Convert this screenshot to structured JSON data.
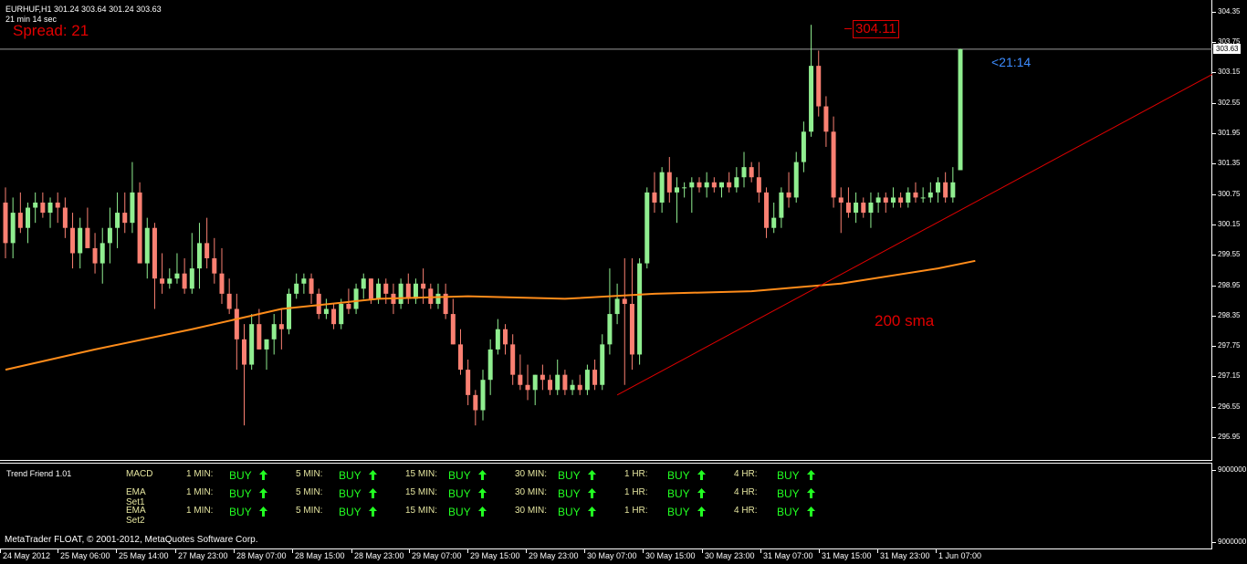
{
  "header": {
    "symbol_line": "EURHUF,H1  301.24 303.64 301.24 303.63",
    "timer_line": "21 min 14 sec",
    "spread": "Spread: 21",
    "high_price": "304.11",
    "countdown": "<21:14",
    "sma_label": "200 sma"
  },
  "price_axis": {
    "ticks": [
      "304.35",
      "303.75",
      "303.15",
      "302.55",
      "301.95",
      "301.35",
      "300.75",
      "300.15",
      "299.55",
      "298.95",
      "298.35",
      "297.75",
      "297.15",
      "296.55",
      "295.95"
    ],
    "current_price": "303.63"
  },
  "indicator": {
    "name": "Trend Friend 1.01",
    "axis_ticks": [
      "9000000",
      "9000000"
    ],
    "rows": [
      {
        "label": "MACD",
        "cells": [
          {
            "tf": "1 MIN:",
            "signal": "BUY"
          },
          {
            "tf": "5 MIN:",
            "signal": "BUY"
          },
          {
            "tf": "15 MIN:",
            "signal": "BUY"
          },
          {
            "tf": "30 MIN:",
            "signal": "BUY"
          },
          {
            "tf": "1 HR:",
            "signal": "BUY"
          },
          {
            "tf": "4 HR:",
            "signal": "BUY"
          }
        ]
      },
      {
        "label": "EMA Set1",
        "cells": [
          {
            "tf": "1 MIN:",
            "signal": "BUY"
          },
          {
            "tf": "5 MIN:",
            "signal": "BUY"
          },
          {
            "tf": "15 MIN:",
            "signal": "BUY"
          },
          {
            "tf": "30 MIN:",
            "signal": "BUY"
          },
          {
            "tf": "1 HR:",
            "signal": "BUY"
          },
          {
            "tf": "4 HR:",
            "signal": "BUY"
          }
        ]
      },
      {
        "label": "EMA Set2",
        "cells": [
          {
            "tf": "1 MIN:",
            "signal": "BUY"
          },
          {
            "tf": "5 MIN:",
            "signal": "BUY"
          },
          {
            "tf": "15 MIN:",
            "signal": "BUY"
          },
          {
            "tf": "30 MIN:",
            "signal": "BUY"
          },
          {
            "tf": "1 HR:",
            "signal": "BUY"
          },
          {
            "tf": "4 HR:",
            "signal": "BUY"
          }
        ]
      }
    ],
    "copyright": "MetaTrader FLOAT, © 2001-2012, MetaQuotes Software Corp."
  },
  "time_axis": {
    "ticks": [
      "24 May 2012",
      "25 May 06:00",
      "25 May 14:00",
      "27 May 23:00",
      "28 May 07:00",
      "28 May 15:00",
      "28 May 23:00",
      "29 May 07:00",
      "29 May 15:00",
      "29 May 23:00",
      "30 May 07:00",
      "30 May 15:00",
      "30 May 23:00",
      "31 May 07:00",
      "31 May 15:00",
      "31 May 23:00",
      "1 Jun 07:00"
    ]
  },
  "colors": {
    "bull": "#90ee90",
    "bear": "#fa8072",
    "sma": "#ff8c1a",
    "trendline": "#e00000",
    "signal": "#22ff22"
  },
  "chart_data": {
    "type": "candlestick",
    "symbol": "EURHUF",
    "timeframe": "H1",
    "ylim": [
      295.8,
      304.5
    ],
    "candles": [
      [
        300.6,
        300.9,
        299.5,
        299.8
      ],
      [
        299.8,
        300.7,
        299.5,
        300.4
      ],
      [
        300.4,
        300.8,
        300.0,
        300.1
      ],
      [
        300.1,
        300.6,
        299.8,
        300.5
      ],
      [
        300.5,
        300.8,
        300.2,
        300.6
      ],
      [
        300.6,
        300.8,
        300.3,
        300.4
      ],
      [
        300.4,
        300.7,
        300.1,
        300.6
      ],
      [
        300.6,
        300.8,
        300.2,
        300.5
      ],
      [
        300.5,
        300.7,
        299.9,
        300.1
      ],
      [
        300.1,
        300.4,
        299.3,
        299.6
      ],
      [
        299.6,
        300.3,
        299.3,
        300.1
      ],
      [
        300.1,
        300.5,
        299.7,
        299.7
      ],
      [
        299.7,
        300.0,
        299.2,
        299.4
      ],
      [
        299.4,
        300.1,
        299.0,
        299.8
      ],
      [
        299.8,
        300.5,
        299.4,
        300.1
      ],
      [
        300.1,
        300.8,
        299.7,
        300.4
      ],
      [
        300.4,
        300.8,
        300.0,
        300.2
      ],
      [
        300.2,
        301.4,
        300.0,
        300.8
      ],
      [
        300.8,
        301.0,
        299.4,
        299.4
      ],
      [
        299.4,
        300.3,
        299.1,
        300.1
      ],
      [
        300.1,
        300.2,
        298.5,
        299.1
      ],
      [
        299.1,
        299.6,
        298.8,
        299.0
      ],
      [
        299.0,
        299.3,
        298.9,
        299.1
      ],
      [
        299.1,
        299.6,
        299.0,
        299.2
      ],
      [
        299.2,
        299.5,
        298.8,
        298.9
      ],
      [
        298.9,
        300.0,
        298.8,
        299.3
      ],
      [
        299.3,
        300.2,
        298.9,
        299.8
      ],
      [
        299.8,
        300.3,
        299.3,
        299.5
      ],
      [
        299.5,
        299.9,
        299.0,
        299.2
      ],
      [
        299.2,
        299.7,
        298.6,
        298.8
      ],
      [
        298.8,
        299.1,
        298.4,
        298.5
      ],
      [
        298.5,
        298.8,
        297.3,
        297.9
      ],
      [
        297.9,
        298.2,
        296.2,
        297.4
      ],
      [
        297.4,
        298.4,
        297.3,
        298.2
      ],
      [
        298.2,
        298.5,
        297.7,
        297.7
      ],
      [
        297.7,
        297.9,
        297.3,
        297.9
      ],
      [
        297.9,
        298.4,
        297.6,
        298.2
      ],
      [
        298.2,
        298.5,
        297.7,
        298.1
      ],
      [
        298.1,
        298.9,
        298.0,
        298.8
      ],
      [
        298.8,
        299.2,
        298.7,
        299.0
      ],
      [
        299.0,
        299.2,
        298.8,
        299.1
      ],
      [
        299.1,
        299.2,
        298.6,
        298.8
      ],
      [
        298.8,
        298.9,
        298.3,
        298.4
      ],
      [
        298.4,
        298.7,
        298.3,
        298.5
      ],
      [
        298.5,
        298.6,
        298.1,
        298.2
      ],
      [
        298.2,
        298.7,
        298.1,
        298.6
      ],
      [
        298.6,
        298.9,
        298.4,
        298.5
      ],
      [
        298.5,
        299.0,
        298.4,
        298.9
      ],
      [
        298.9,
        299.2,
        298.7,
        299.1
      ],
      [
        299.1,
        299.1,
        298.6,
        298.7
      ],
      [
        298.7,
        299.1,
        298.6,
        299.0
      ],
      [
        299.0,
        299.1,
        298.6,
        298.8
      ],
      [
        298.8,
        299.0,
        298.4,
        298.6
      ],
      [
        298.6,
        299.1,
        298.5,
        299.0
      ],
      [
        299.0,
        299.2,
        298.6,
        298.7
      ],
      [
        298.7,
        299.1,
        298.6,
        299.0
      ],
      [
        299.0,
        299.3,
        298.6,
        298.9
      ],
      [
        298.9,
        299.0,
        298.5,
        298.6
      ],
      [
        298.6,
        299.0,
        298.5,
        298.8
      ],
      [
        298.8,
        299.0,
        298.3,
        298.4
      ],
      [
        298.4,
        298.7,
        297.8,
        297.8
      ],
      [
        297.8,
        298.1,
        297.2,
        297.3
      ],
      [
        297.3,
        297.5,
        296.6,
        296.8
      ],
      [
        296.8,
        296.9,
        296.2,
        296.5
      ],
      [
        296.5,
        297.3,
        296.3,
        297.1
      ],
      [
        297.1,
        297.9,
        296.8,
        297.7
      ],
      [
        297.7,
        298.3,
        297.6,
        298.1
      ],
      [
        298.1,
        298.2,
        297.6,
        297.8
      ],
      [
        297.8,
        298.0,
        297.0,
        297.2
      ],
      [
        297.2,
        297.6,
        296.9,
        297.0
      ],
      [
        297.0,
        297.4,
        296.7,
        296.9
      ],
      [
        296.9,
        297.2,
        296.6,
        297.2
      ],
      [
        297.2,
        297.4,
        296.9,
        297.1
      ],
      [
        297.1,
        297.2,
        296.8,
        296.9
      ],
      [
        296.9,
        297.5,
        296.8,
        297.2
      ],
      [
        297.2,
        297.3,
        296.8,
        296.9
      ],
      [
        296.9,
        297.1,
        296.8,
        297.0
      ],
      [
        297.0,
        297.2,
        296.8,
        296.9
      ],
      [
        296.9,
        297.4,
        296.8,
        297.3
      ],
      [
        297.3,
        297.5,
        296.9,
        297.0
      ],
      [
        297.0,
        298.0,
        296.9,
        297.8
      ],
      [
        297.8,
        299.3,
        297.6,
        298.4
      ],
      [
        298.4,
        299.0,
        298.2,
        298.7
      ],
      [
        298.7,
        299.5,
        297.0,
        298.6
      ],
      [
        298.6,
        299.5,
        297.3,
        297.6
      ],
      [
        297.6,
        299.5,
        297.4,
        299.4
      ],
      [
        299.4,
        300.9,
        299.3,
        300.8
      ],
      [
        300.8,
        301.2,
        300.4,
        300.6
      ],
      [
        300.6,
        301.3,
        300.4,
        301.2
      ],
      [
        301.2,
        301.5,
        300.6,
        300.8
      ],
      [
        300.8,
        301.1,
        300.2,
        300.9
      ],
      [
        300.9,
        301.0,
        300.7,
        300.9
      ],
      [
        300.9,
        301.1,
        300.4,
        301.0
      ],
      [
        301.0,
        301.1,
        300.8,
        300.9
      ],
      [
        300.9,
        301.2,
        300.7,
        301.0
      ],
      [
        301.0,
        301.1,
        300.8,
        300.9
      ],
      [
        300.9,
        301.0,
        300.7,
        301.0
      ],
      [
        301.0,
        301.2,
        300.8,
        300.9
      ],
      [
        300.9,
        301.3,
        300.8,
        301.1
      ],
      [
        301.1,
        301.6,
        300.9,
        301.3
      ],
      [
        301.3,
        301.4,
        301.0,
        301.1
      ],
      [
        301.1,
        301.4,
        300.6,
        300.8
      ],
      [
        300.8,
        300.9,
        299.9,
        300.1
      ],
      [
        300.1,
        300.6,
        300.0,
        300.3
      ],
      [
        300.3,
        300.9,
        300.1,
        300.8
      ],
      [
        300.8,
        301.2,
        300.5,
        300.7
      ],
      [
        300.7,
        301.6,
        300.6,
        301.4
      ],
      [
        301.4,
        302.2,
        301.2,
        302.0
      ],
      [
        302.0,
        304.11,
        301.9,
        303.3
      ],
      [
        303.3,
        303.6,
        302.3,
        302.5
      ],
      [
        302.5,
        302.7,
        301.7,
        302.0
      ],
      [
        302.0,
        302.3,
        300.5,
        300.7
      ],
      [
        300.7,
        300.9,
        300.0,
        300.6
      ],
      [
        300.6,
        300.9,
        300.3,
        300.4
      ],
      [
        300.4,
        300.8,
        300.2,
        300.6
      ],
      [
        300.6,
        300.7,
        300.3,
        300.4
      ],
      [
        300.4,
        300.8,
        300.1,
        300.6
      ],
      [
        300.6,
        300.8,
        300.4,
        300.7
      ],
      [
        300.7,
        300.8,
        300.4,
        300.6
      ],
      [
        300.6,
        300.9,
        300.5,
        300.7
      ],
      [
        300.7,
        300.8,
        300.5,
        300.6
      ],
      [
        300.6,
        300.9,
        300.5,
        300.8
      ],
      [
        300.8,
        301.0,
        300.6,
        300.7
      ],
      [
        300.7,
        300.9,
        300.6,
        300.7
      ],
      [
        300.7,
        301.0,
        300.6,
        300.8
      ],
      [
        300.8,
        301.1,
        300.6,
        301.0
      ],
      [
        301.0,
        301.2,
        300.6,
        300.7
      ],
      [
        300.7,
        301.3,
        300.6,
        301.0
      ],
      [
        301.24,
        303.64,
        301.24,
        303.63
      ]
    ],
    "sma200": {
      "name": "200 sma",
      "points": [
        [
          0,
          297.3
        ],
        [
          12,
          297.7
        ],
        [
          25,
          298.1
        ],
        [
          37,
          298.5
        ],
        [
          50,
          298.7
        ],
        [
          62,
          298.75
        ],
        [
          75,
          298.7
        ],
        [
          87,
          298.8
        ],
        [
          100,
          298.85
        ],
        [
          112,
          299.0
        ],
        [
          125,
          299.3
        ],
        [
          130,
          299.45
        ]
      ]
    },
    "trendline": {
      "from": [
        82,
        296.8
      ],
      "to": [
        162,
        303.15
      ]
    }
  }
}
